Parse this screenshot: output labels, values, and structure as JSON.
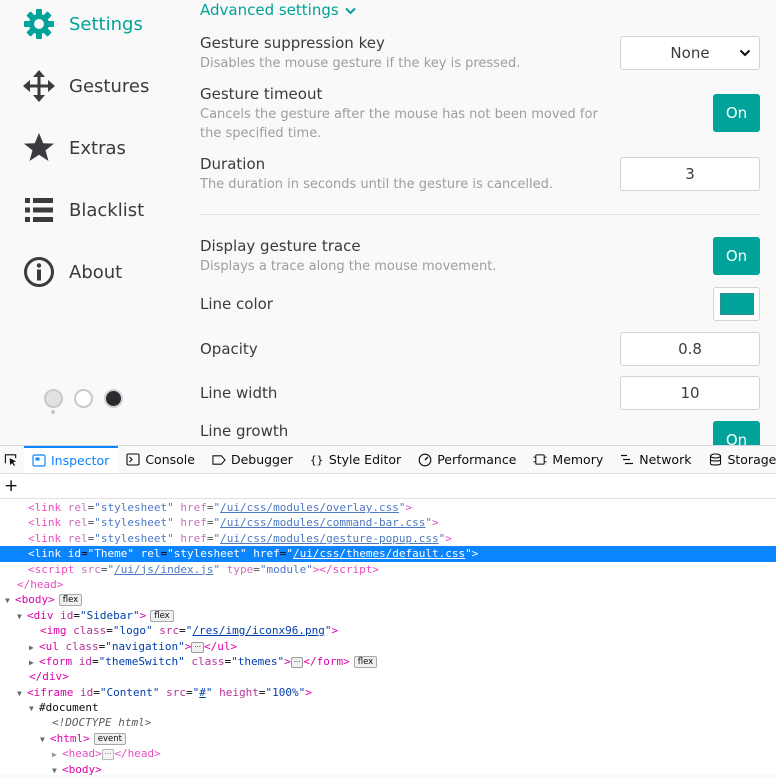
{
  "sidebar": {
    "items": [
      {
        "label": "Settings",
        "icon": "gear-icon",
        "active": true
      },
      {
        "label": "Gestures",
        "icon": "move-arrows-icon"
      },
      {
        "label": "Extras",
        "icon": "star-icon"
      },
      {
        "label": "Blacklist",
        "icon": "list-icon"
      },
      {
        "label": "About",
        "icon": "info-icon"
      }
    ],
    "themes": [
      "light",
      "white",
      "dark"
    ]
  },
  "settings": {
    "advanced_label": "Advanced settings",
    "suppression": {
      "title": "Gesture suppression key",
      "desc": "Disables the mouse gesture if the key is pressed.",
      "value": "None"
    },
    "timeout": {
      "title": "Gesture timeout",
      "desc": "Cancels the gesture after the mouse has not been moved for the specified time.",
      "value": "On"
    },
    "duration": {
      "title": "Duration",
      "desc": "The duration in seconds until the gesture is cancelled.",
      "value": "3"
    },
    "trace": {
      "title": "Display gesture trace",
      "desc": "Displays a trace along the mouse movement.",
      "value": "On"
    },
    "line_color": {
      "title": "Line color",
      "value": "#00a39a"
    },
    "opacity": {
      "title": "Opacity",
      "value": "0.8"
    },
    "line_width": {
      "title": "Line width",
      "value": "10"
    },
    "line_growth": {
      "title": "Line growth",
      "value": "On"
    }
  },
  "devtools": {
    "tabs": [
      "Inspector",
      "Console",
      "Debugger",
      "Style Editor",
      "Performance",
      "Memory",
      "Network",
      "Storage"
    ],
    "active_tab": "Inspector"
  },
  "colors": {
    "accent": "#00a39a",
    "devtools_accent": "#0a84ff"
  }
}
